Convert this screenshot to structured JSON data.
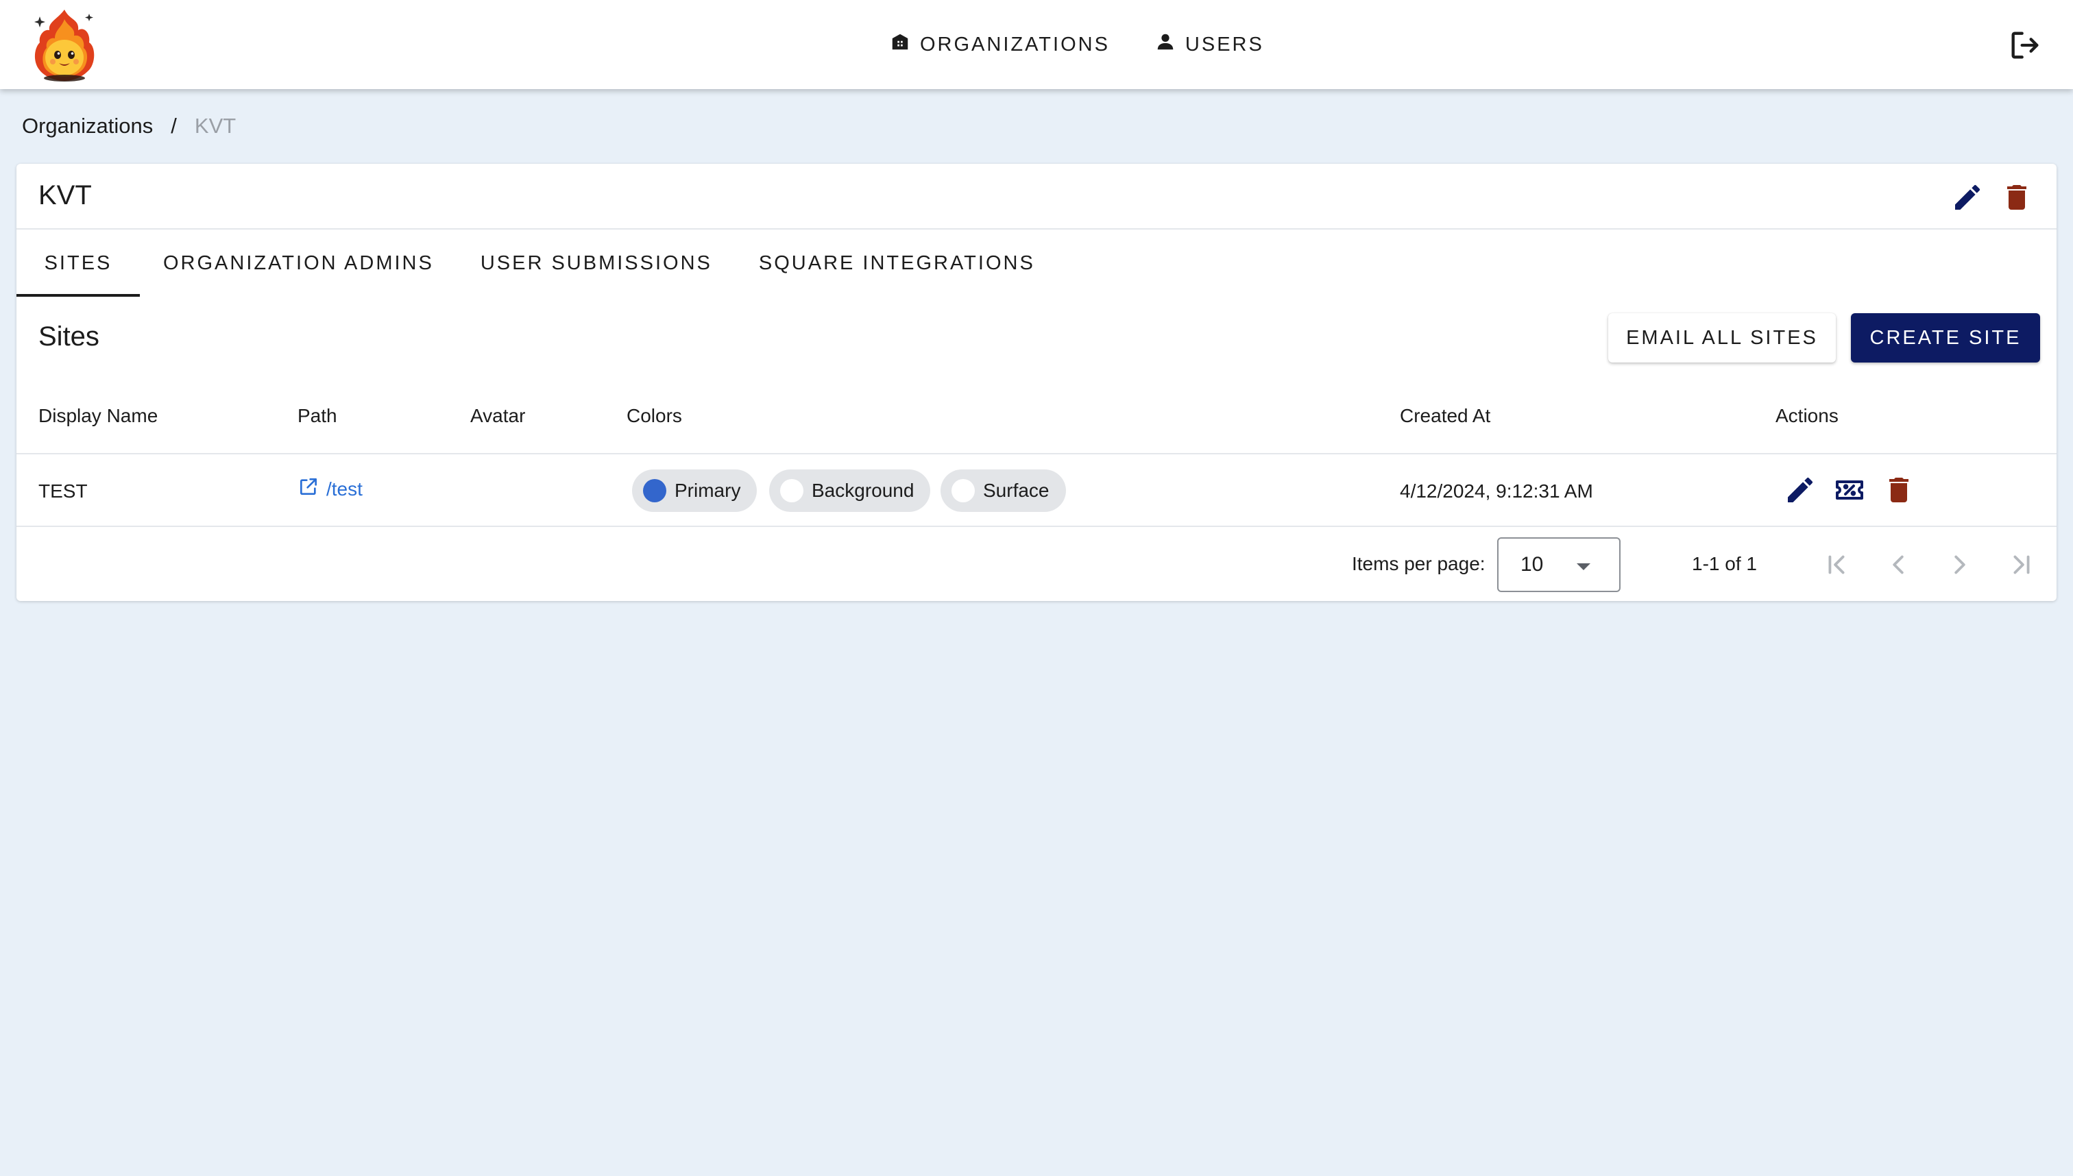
{
  "appbar": {
    "nav": [
      {
        "label": "ORGANIZATIONS",
        "icon": "organization-icon"
      },
      {
        "label": "USERS",
        "icon": "person-icon"
      }
    ],
    "logout_icon": "logout-icon"
  },
  "breadcrumb": {
    "parent": "Organizations",
    "separator": "/",
    "current": "KVT"
  },
  "org": {
    "title": "KVT"
  },
  "tabs": [
    "SITES",
    "ORGANIZATION ADMINS",
    "USER SUBMISSIONS",
    "SQUARE INTEGRATIONS"
  ],
  "active_tab": "SITES",
  "sites": {
    "title": "Sites",
    "email_all_label": "EMAIL ALL SITES",
    "create_label": "CREATE SITE",
    "columns": [
      "Display Name",
      "Path",
      "Avatar",
      "Colors",
      "Created At",
      "Actions"
    ],
    "rows": [
      {
        "display_name": "TEST",
        "path": "/test",
        "avatar": "",
        "colors": [
          {
            "label": "Primary",
            "swatch": "#3366cc"
          },
          {
            "label": "Background",
            "swatch": "#ffffff"
          },
          {
            "label": "Surface",
            "swatch": "#ffffff"
          }
        ],
        "created_at": "4/12/2024, 9:12:31 AM"
      }
    ]
  },
  "pagination": {
    "items_per_page_label": "Items per page:",
    "items_per_page": "10",
    "range": "1-1 of 1"
  },
  "colors": {
    "primary": "#0d1b63",
    "danger": "#8b2a14",
    "link": "#2a6fd6",
    "background": "#e8f0f8"
  }
}
